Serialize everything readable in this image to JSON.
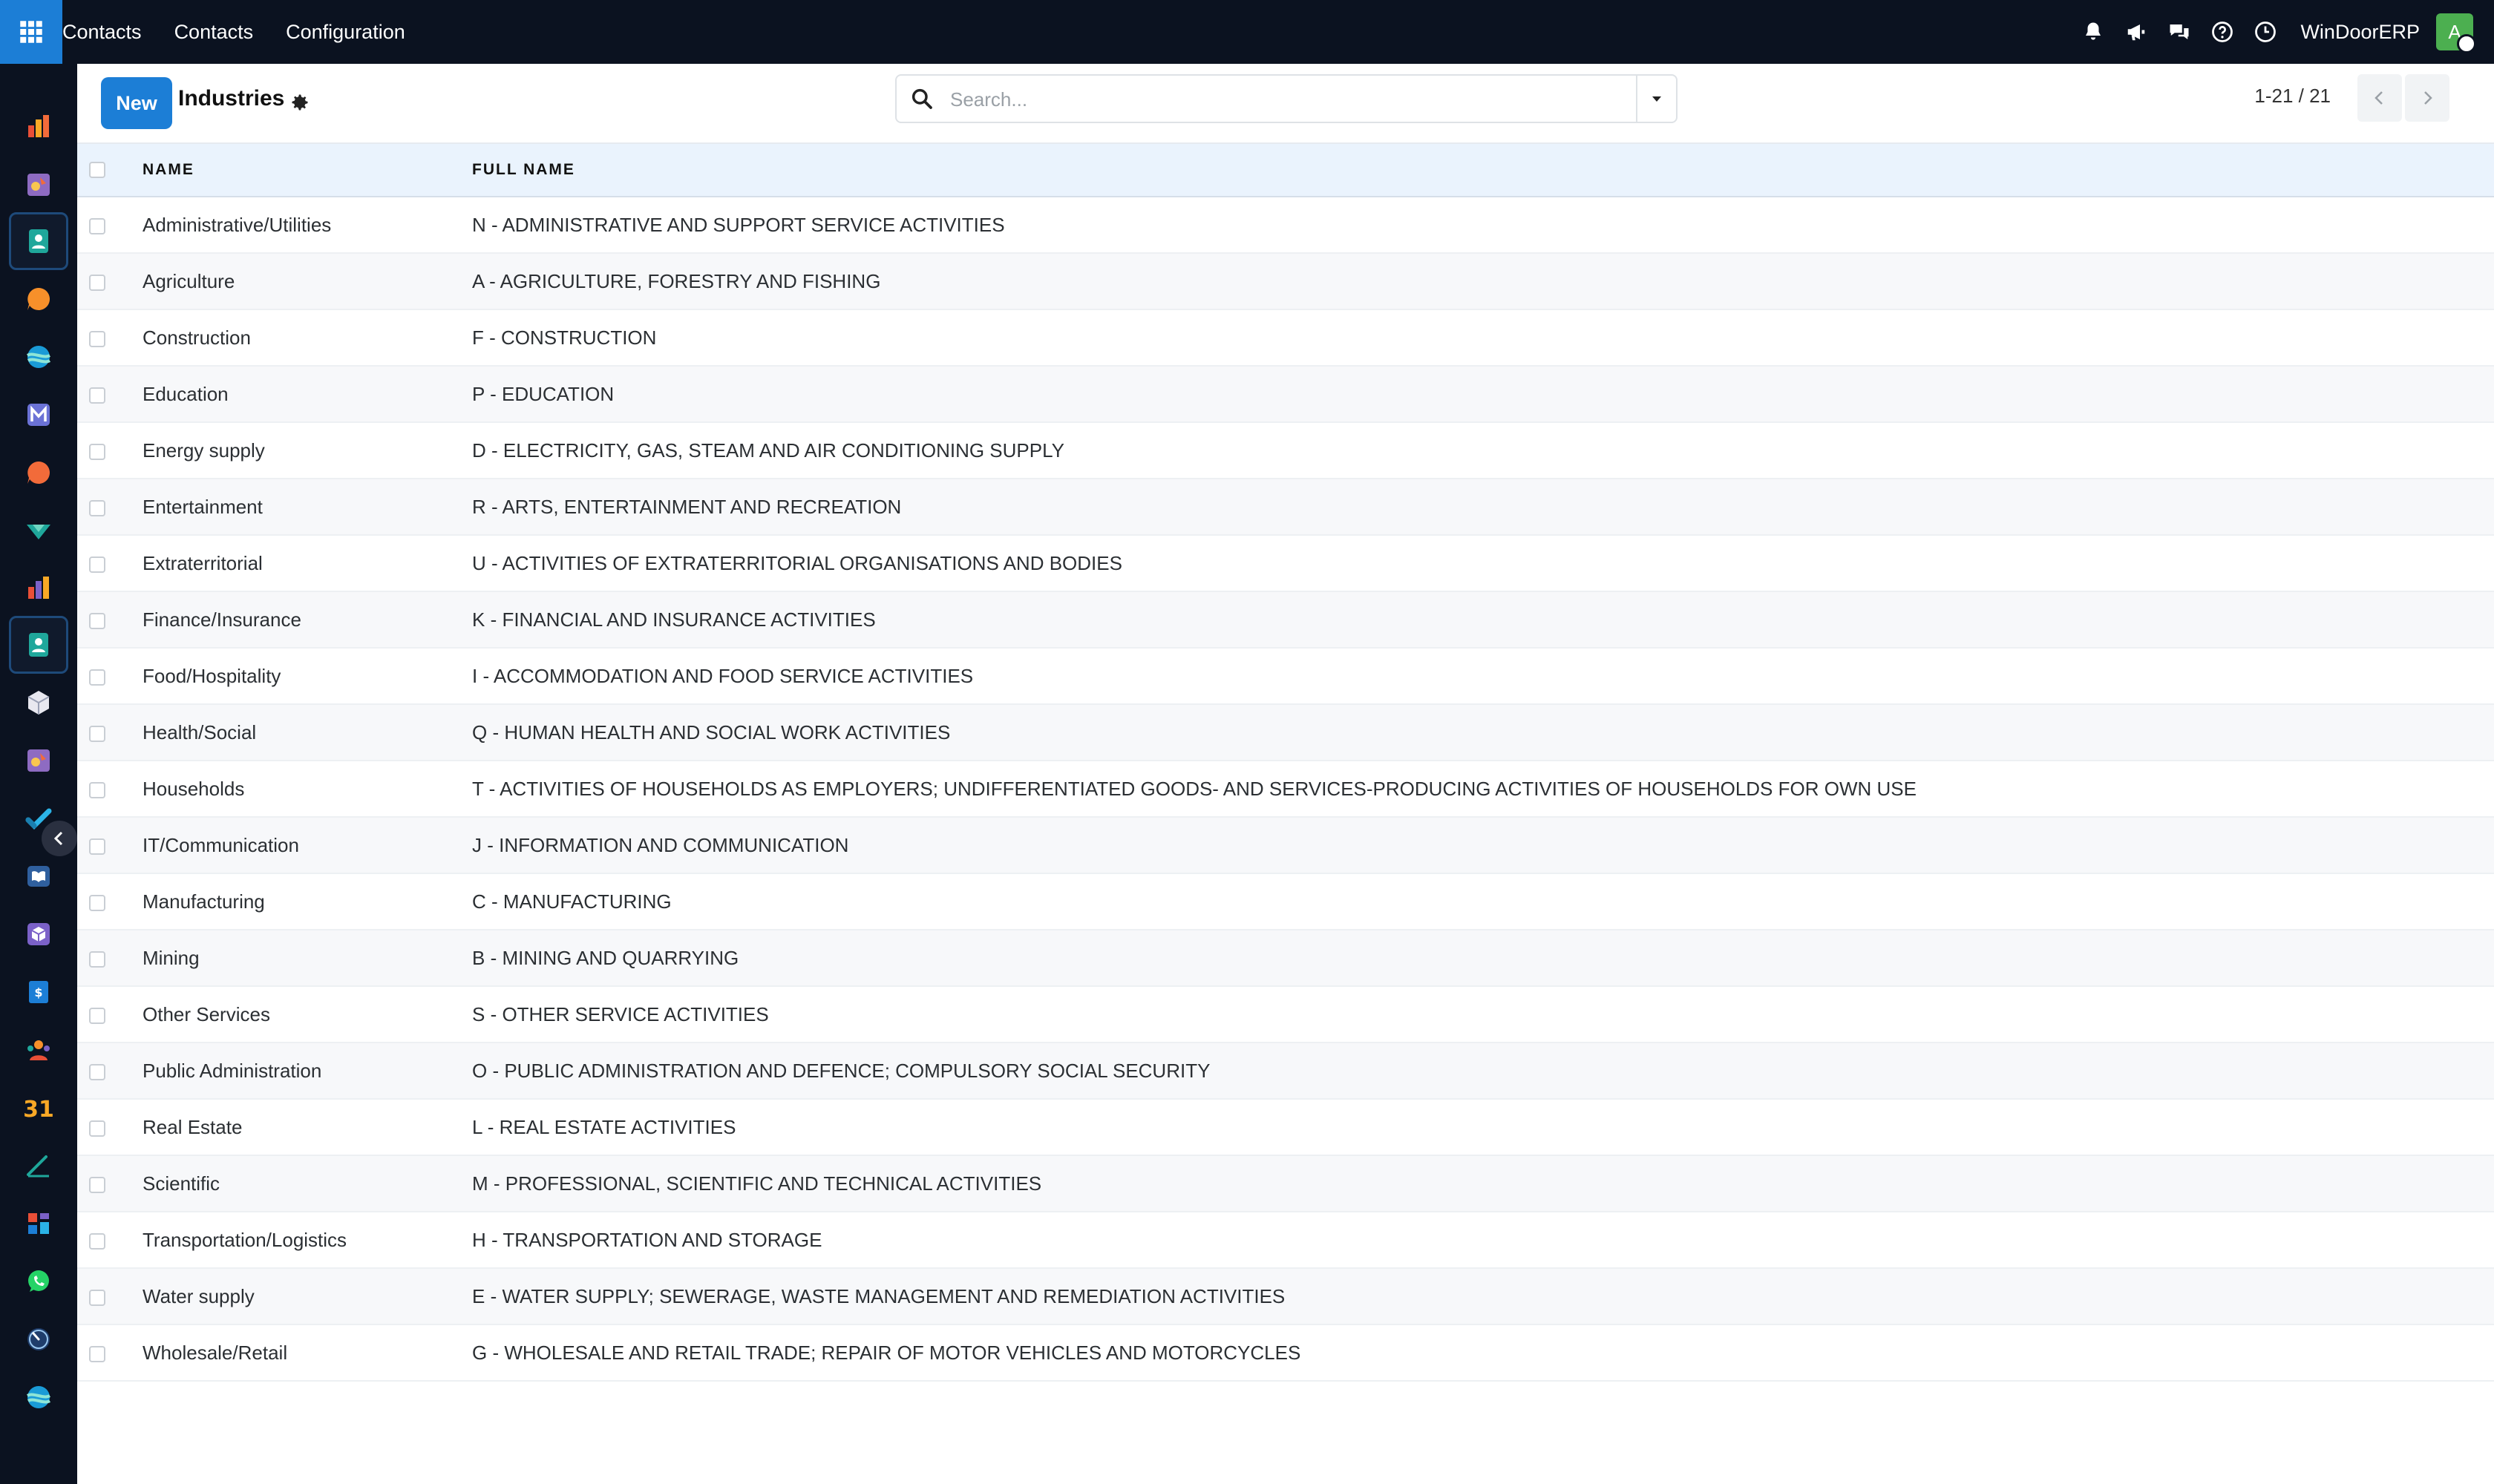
{
  "navbar": {
    "app_name": "Contacts",
    "menu": [
      "Contacts",
      "Configuration"
    ],
    "company": "WinDoorERP",
    "avatar_initial": "A"
  },
  "sidebar": {
    "apps": [
      "dashboards-icon",
      "sales-icon",
      "contacts-icon",
      "discuss-icon",
      "website-icon",
      "email-marketing-icon",
      "livechat-icon",
      "inventory-icon",
      "spreadsheet-icon",
      "contacts-icon",
      "product-icon",
      "sales-icon",
      "project-icon",
      "knowledge-icon",
      "manufacturing-icon",
      "invoicing-icon",
      "employees-icon",
      "calendar-icon",
      "sign-icon",
      "dashboard-icon",
      "whatsapp-icon",
      "timesheets-icon",
      "website-icon"
    ],
    "calendar_label": "31"
  },
  "control": {
    "new_label": "New",
    "title": "Industries",
    "search_placeholder": "Search...",
    "pager": "1-21 / 21"
  },
  "table": {
    "columns": [
      "NAME",
      "FULL NAME"
    ],
    "rows": [
      {
        "name": "Administrative/Utilities",
        "full_name": "N - ADMINISTRATIVE AND SUPPORT SERVICE ACTIVITIES"
      },
      {
        "name": "Agriculture",
        "full_name": "A - AGRICULTURE, FORESTRY AND FISHING"
      },
      {
        "name": "Construction",
        "full_name": "F - CONSTRUCTION"
      },
      {
        "name": "Education",
        "full_name": "P - EDUCATION"
      },
      {
        "name": "Energy supply",
        "full_name": "D - ELECTRICITY, GAS, STEAM AND AIR CONDITIONING SUPPLY"
      },
      {
        "name": "Entertainment",
        "full_name": "R - ARTS, ENTERTAINMENT AND RECREATION"
      },
      {
        "name": "Extraterritorial",
        "full_name": "U - ACTIVITIES OF EXTRATERRITORIAL ORGANISATIONS AND BODIES"
      },
      {
        "name": "Finance/Insurance",
        "full_name": "K - FINANCIAL AND INSURANCE ACTIVITIES"
      },
      {
        "name": "Food/Hospitality",
        "full_name": "I - ACCOMMODATION AND FOOD SERVICE ACTIVITIES"
      },
      {
        "name": "Health/Social",
        "full_name": "Q - HUMAN HEALTH AND SOCIAL WORK ACTIVITIES"
      },
      {
        "name": "Households",
        "full_name": "T - ACTIVITIES OF HOUSEHOLDS AS EMPLOYERS; UNDIFFERENTIATED GOODS- AND SERVICES-PRODUCING ACTIVITIES OF HOUSEHOLDS FOR OWN USE"
      },
      {
        "name": "IT/Communication",
        "full_name": "J - INFORMATION AND COMMUNICATION"
      },
      {
        "name": "Manufacturing",
        "full_name": "C - MANUFACTURING"
      },
      {
        "name": "Mining",
        "full_name": "B - MINING AND QUARRYING"
      },
      {
        "name": "Other Services",
        "full_name": "S - OTHER SERVICE ACTIVITIES"
      },
      {
        "name": "Public Administration",
        "full_name": "O - PUBLIC ADMINISTRATION AND DEFENCE; COMPULSORY SOCIAL SECURITY"
      },
      {
        "name": "Real Estate",
        "full_name": "L - REAL ESTATE ACTIVITIES"
      },
      {
        "name": "Scientific",
        "full_name": "M - PROFESSIONAL, SCIENTIFIC AND TECHNICAL ACTIVITIES"
      },
      {
        "name": "Transportation/Logistics",
        "full_name": "H - TRANSPORTATION AND STORAGE"
      },
      {
        "name": "Water supply",
        "full_name": "E - WATER SUPPLY; SEWERAGE, WASTE MANAGEMENT AND REMEDIATION ACTIVITIES"
      },
      {
        "name": "Wholesale/Retail",
        "full_name": "G - WHOLESALE AND RETAIL TRADE; REPAIR OF MOTOR VEHICLES AND MOTORCYCLES"
      }
    ]
  },
  "colors": {
    "navbar_bg": "#0b1220",
    "primary": "#1c7ed6",
    "header_row_bg": "#eaf3fd"
  }
}
